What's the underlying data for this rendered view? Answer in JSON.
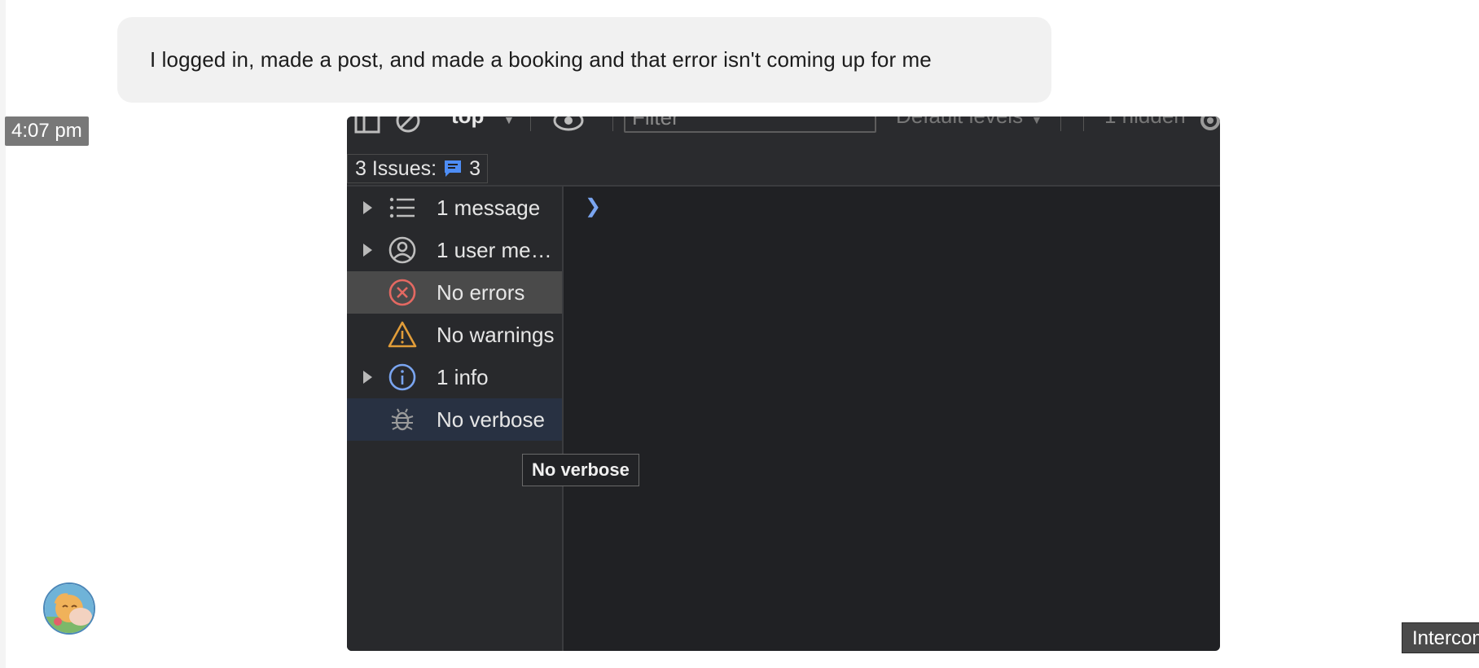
{
  "message": {
    "text": "I logged in, made a post, and made a booking and that error isn't coming up for me",
    "timestamp": "4:07 pm"
  },
  "devtools": {
    "toolbar": {
      "context": "top",
      "filter_placeholder": "Filter",
      "levels": "Default levels",
      "hidden": "1 hidden"
    },
    "issues": {
      "label": "3 Issues:",
      "count": "3"
    },
    "sidebar": {
      "items": [
        {
          "label": "1 message",
          "icon": "list-icon"
        },
        {
          "label": "1 user me…",
          "icon": "user-icon"
        },
        {
          "label": "No errors",
          "icon": "error-icon"
        },
        {
          "label": "No warnings",
          "icon": "warning-icon"
        },
        {
          "label": "1 info",
          "icon": "info-icon"
        },
        {
          "label": "No verbose",
          "icon": "bug-icon"
        }
      ]
    },
    "tooltip": "No verbose",
    "colors": {
      "error": "#e46962",
      "warning": "#e29d39",
      "info": "#7aa5f0",
      "issue": "#4e8df5"
    }
  },
  "intercom_label": "Intercom"
}
